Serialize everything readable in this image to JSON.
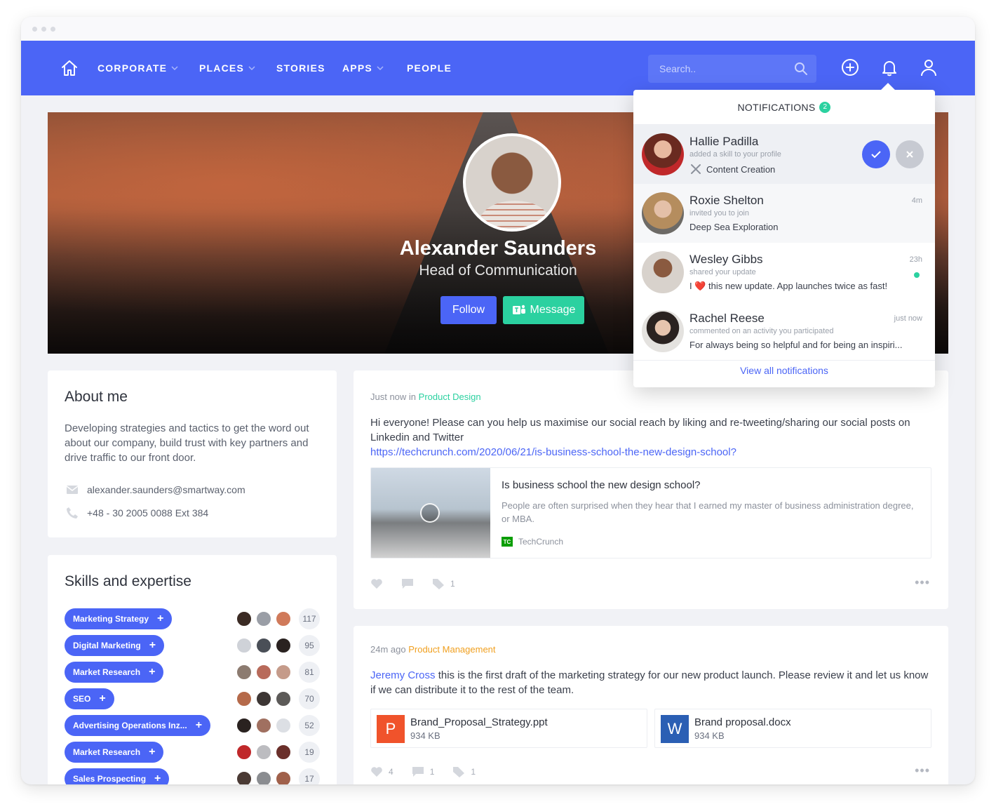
{
  "nav": {
    "items": [
      {
        "label": "CORPORATE",
        "dropdown": true
      },
      {
        "label": "PLACES",
        "dropdown": true
      },
      {
        "label": "STORIES",
        "dropdown": false
      },
      {
        "label": "APPS",
        "dropdown": true
      },
      {
        "label": "PEOPLE",
        "dropdown": false
      }
    ],
    "search_placeholder": "Search.."
  },
  "profile": {
    "name": "Alexander Saunders",
    "role": "Head of Communication",
    "follow_label": "Follow",
    "message_label": "Message"
  },
  "about": {
    "title": "About me",
    "text": "Developing strategies and tactics to get the word out about our company, build trust with key partners and drive traffic to our front door.",
    "email": "alexander.saunders@smartway.com",
    "phone": "+48 - 30 2005 0088 Ext 384"
  },
  "skills": {
    "title": "Skills and expertise",
    "items": [
      {
        "label": "Marketing Strategy",
        "count": "117"
      },
      {
        "label": "Digital Marketing",
        "count": "95"
      },
      {
        "label": "Market Research",
        "count": "81"
      },
      {
        "label": "SEO",
        "count": "70"
      },
      {
        "label": "Advertising Operations Inz...",
        "count": "52"
      },
      {
        "label": "Market Research",
        "count": "19"
      },
      {
        "label": "Sales Prospecting",
        "count": "17"
      }
    ]
  },
  "posts": [
    {
      "time": "Just now in",
      "category": "Product Design",
      "text": "Hi everyone! Please can you help us maximise our social reach by liking and re-tweeting/sharing our social posts on Linkedin and Twitter",
      "link": "https://techcrunch.com/2020/06/21/is-business-school-the-new-design-school?",
      "preview": {
        "title": "Is business school the new design school?",
        "description": "People are often surprised when they hear that I earned my master of business administration degree, or MBA.",
        "source": "TechCrunch",
        "source_logo": "TC"
      },
      "tags_count": "1"
    },
    {
      "time": "24m ago",
      "category": "Product Management",
      "author": "Jeremy Cross",
      "text": "this is the first draft of the marketing strategy for our new product launch. Please review it and let us know if we can distribute it to the rest of the team.",
      "files": [
        {
          "name": "Brand_Proposal_Strategy.ppt",
          "size": "934 KB",
          "letter": "P",
          "color": "#f0532b"
        },
        {
          "name": "Brand proposal.docx",
          "size": "934 KB",
          "letter": "W",
          "color": "#2b5fb4"
        }
      ],
      "likes": "4",
      "comments": "1",
      "tags_count": "1"
    }
  ],
  "notifications": {
    "title": "NOTIFICATIONS",
    "count": "2",
    "items": [
      {
        "name": "Hallie Padilla",
        "action": "added a skill to your profile",
        "detail": "Content Creation",
        "time": ""
      },
      {
        "name": "Roxie Shelton",
        "action": "invited you to join",
        "detail": "Deep Sea Exploration",
        "time": "4m"
      },
      {
        "name": "Wesley Gibbs",
        "action": "shared your update",
        "detail": "I ❤️ this new update. App launches twice as fast!",
        "time": "23h"
      },
      {
        "name": "Rachel Reese",
        "action": "commented on an activity you participated",
        "detail": "For always being so helpful and for being an inspiri...",
        "time": "just now"
      }
    ],
    "view_all": "View all notifications"
  },
  "colors": {
    "primary": "#4b65f6",
    "accent_green": "#2bd1a0",
    "category_orange": "#f0a020"
  }
}
